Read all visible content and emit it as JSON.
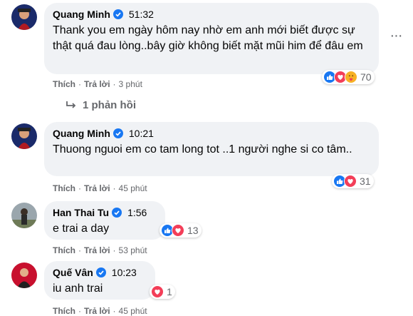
{
  "comments": [
    {
      "name": "Quang Minh",
      "time": "51:32",
      "text": "Thank you em ngày hôm nay nhờ em anh mới biết được sự thật quá đau lòng..bây giờ không biết mặt mũi him để đâu em",
      "reaction_icons": [
        "like-icon",
        "love-icon",
        "care-icon"
      ],
      "reaction_count": "70",
      "like_label": "Thích",
      "reply_label": "Trả lời",
      "age": "3 phút",
      "replies_label": "1 phản hồi"
    },
    {
      "name": "Quang Minh",
      "time": "10:21",
      "text": "Thuong nguoi em co tam long tot ..1 người nghe si co tâm..",
      "reaction_icons": [
        "like-icon",
        "love-icon"
      ],
      "reaction_count": "31",
      "like_label": "Thích",
      "reply_label": "Trả lời",
      "age": "45 phút"
    },
    {
      "name": "Han Thai Tu",
      "time": "1:56",
      "text": "e trai a day",
      "reaction_icons": [
        "like-icon",
        "love-icon"
      ],
      "reaction_count": "13",
      "like_label": "Thích",
      "reply_label": "Trả lời",
      "age": "53 phút"
    },
    {
      "name": "Quế Vân",
      "time": "10:23",
      "text": "iu anh trai",
      "reaction_icons": [
        "love-icon"
      ],
      "reaction_count": "1",
      "like_label": "Thích",
      "reply_label": "Trả lời",
      "age": "45 phút"
    }
  ],
  "colors": {
    "bubble": "#f0f2f5",
    "meta": "#65676b",
    "verified": "#1877f2",
    "like": "#1877f2",
    "love": "#f33e58",
    "care": "#f7b125"
  }
}
